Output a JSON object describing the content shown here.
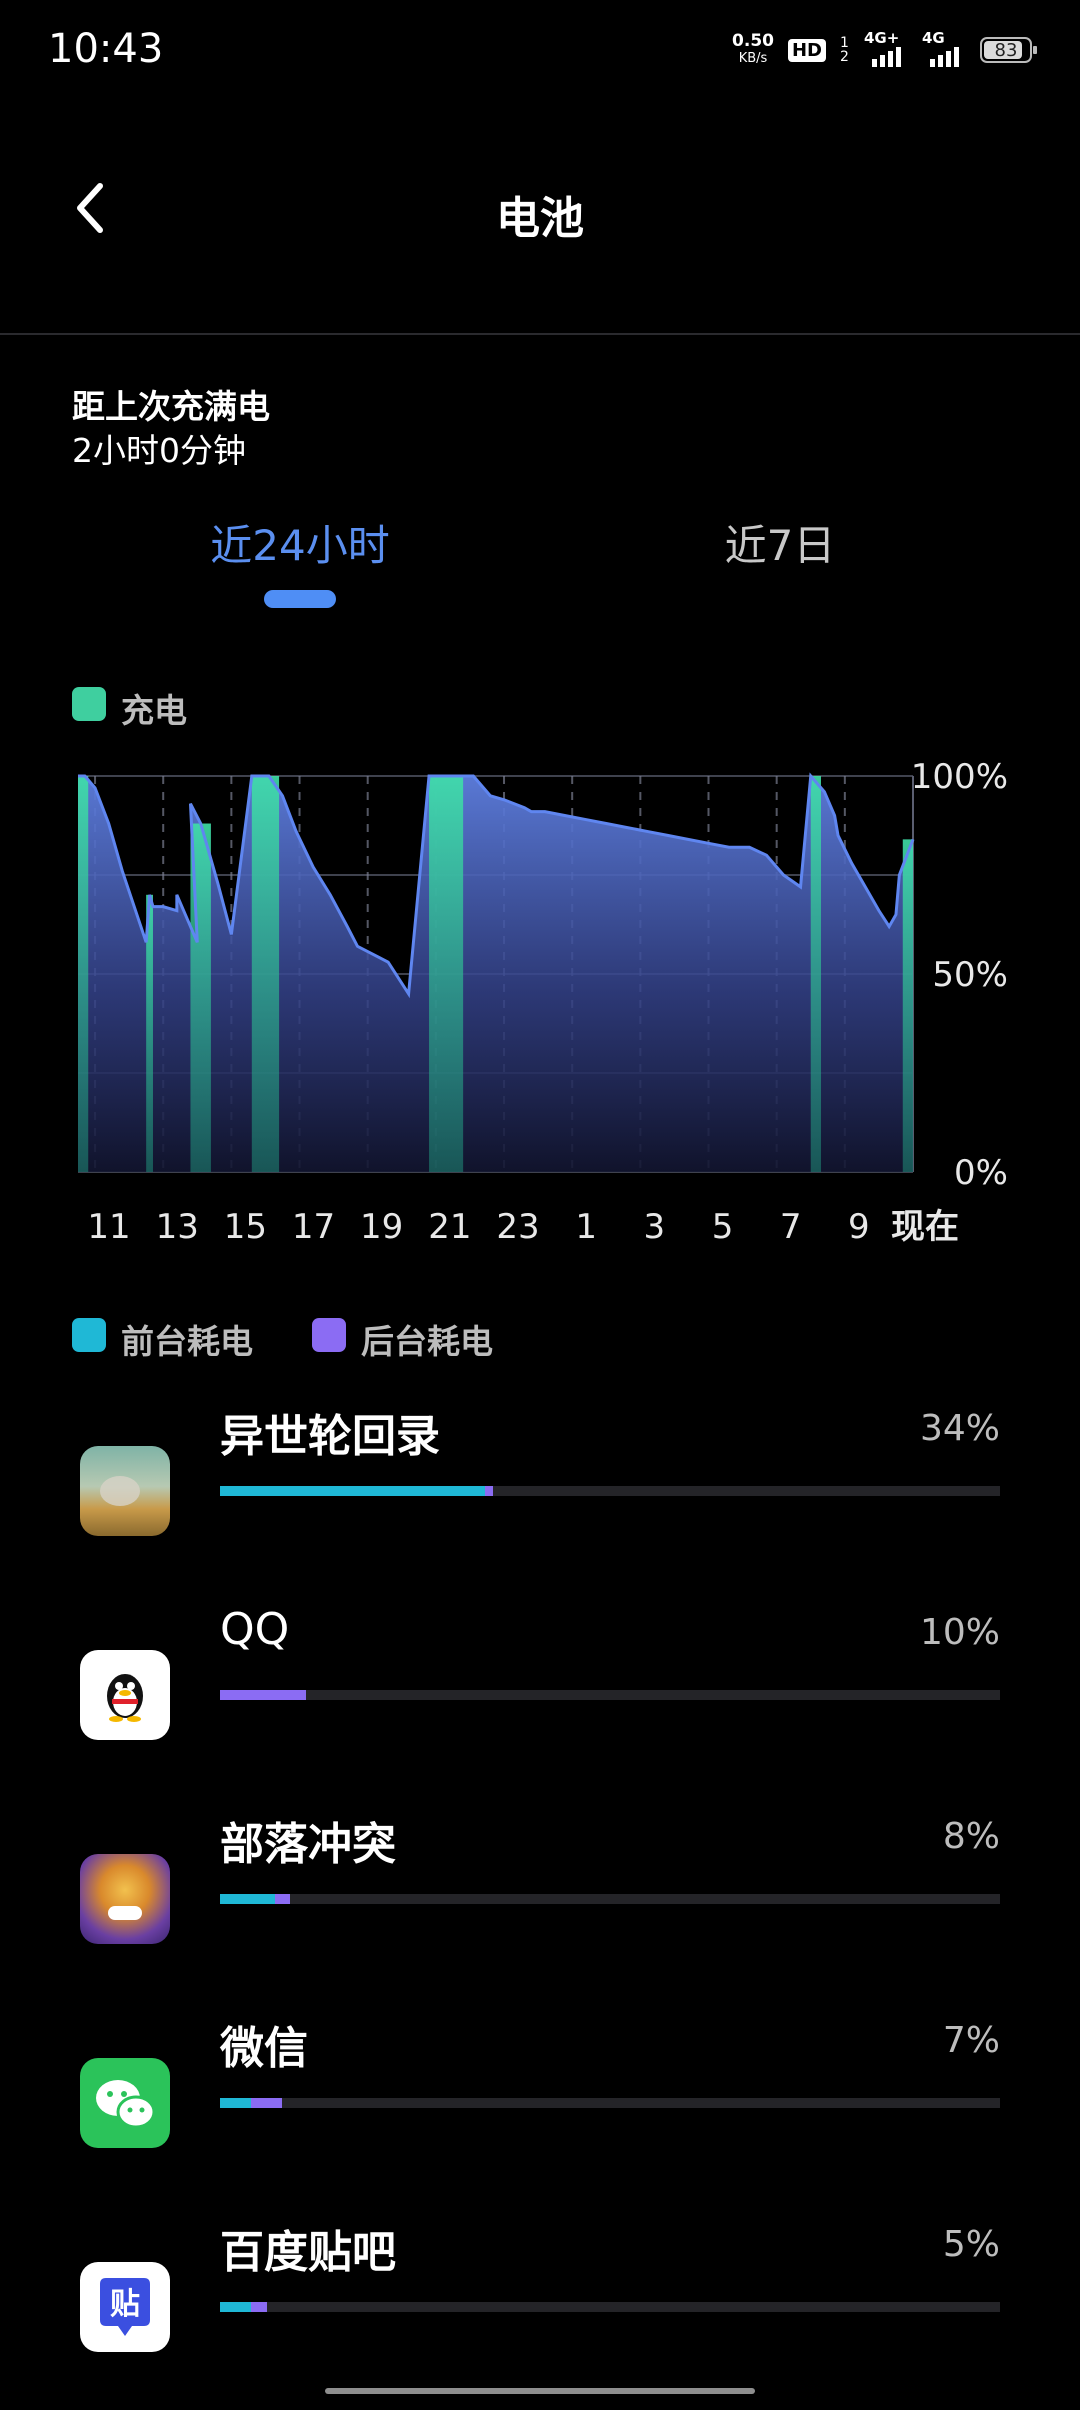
{
  "status_bar": {
    "time": "10:43",
    "net_speed_value": "0.50",
    "net_speed_unit": "KB/s",
    "hd_badge": "HD",
    "sim_slots": "1 2",
    "signal1_label": "4G+",
    "signal2_label": "4G",
    "battery_level": "83"
  },
  "header": {
    "back_icon": "chevron-left-icon",
    "title": "电池"
  },
  "since_full_charge": {
    "label": "距上次充满电",
    "value": "2小时0分钟"
  },
  "tabs": [
    {
      "label": "近24小时",
      "selected": true
    },
    {
      "label": "近7日",
      "selected": false
    }
  ],
  "charge_legend": {
    "label": "充电",
    "color": "#3fcf9f"
  },
  "chart_data": {
    "type": "area",
    "x_tick_labels": [
      "11",
      "13",
      "15",
      "17",
      "19",
      "21",
      "23",
      "1",
      "3",
      "5",
      "7",
      "9",
      "现在"
    ],
    "y_tick_labels": [
      "100%",
      "50%",
      "0%"
    ],
    "ylim": [
      0,
      100
    ],
    "x_unit": "hours ago",
    "xlim": [
      24.5,
      0
    ],
    "battery_level": {
      "x": [
        24.5,
        24.3,
        24.0,
        23.6,
        23.2,
        22.5,
        22.4,
        22.3,
        22.0,
        21.6,
        21.6,
        21.0,
        21.2,
        20.9,
        20.8,
        20.4,
        20.0,
        19.4,
        18.9,
        18.5,
        18.1,
        17.6,
        17.1,
        16.6,
        16.3,
        15.4,
        14.8,
        14.2,
        13.6,
        13.1,
        12.9,
        12.8,
        12.4,
        12.0,
        11.4,
        11.2,
        10.8,
        10.2,
        9.6,
        9.0,
        8.4,
        7.8,
        7.2,
        6.6,
        6.0,
        5.4,
        4.8,
        4.3,
        3.8,
        3.3,
        3.0,
        2.6,
        2.3,
        2.2,
        1.8,
        1.4,
        1.0,
        0.7,
        0.5,
        0.4,
        0.0
      ],
      "values": [
        100,
        100,
        97,
        88,
        76,
        58,
        70,
        67,
        67,
        66,
        70,
        58,
        93,
        88,
        85,
        73,
        60,
        100,
        100,
        95,
        86,
        77,
        70,
        62,
        57,
        53,
        45,
        100,
        100,
        100,
        100,
        99,
        95,
        94,
        92,
        91,
        91,
        90,
        89,
        88,
        87,
        86,
        85,
        84,
        83,
        82,
        82,
        80,
        75,
        72,
        100,
        96,
        90,
        85,
        78,
        72,
        66,
        62,
        65,
        75,
        84
      ]
    },
    "charging_periods": [
      [
        24.5,
        24.2
      ],
      [
        22.5,
        22.3
      ],
      [
        21.2,
        20.6
      ],
      [
        19.4,
        18.6
      ],
      [
        14.2,
        13.2
      ],
      [
        3.0,
        2.7
      ],
      [
        0.3,
        0.0
      ]
    ],
    "colors": {
      "line": "#5f86f0",
      "charging": "#3fcf9f"
    },
    "grid": true
  },
  "usage_legend": {
    "foreground_label": "前台耗电",
    "background_label": "后台耗电",
    "foreground_color": "#1fb8d6",
    "background_color": "#8b6cf3"
  },
  "apps": [
    {
      "name": "异世轮回录",
      "percent": "34%",
      "foreground_fraction": 0.34,
      "background_fraction": 0.01,
      "icon": "game-landscape-icon"
    },
    {
      "name": "QQ",
      "percent": "10%",
      "foreground_fraction": 0.0,
      "background_fraction": 0.11,
      "icon": "qq-penguin-icon"
    },
    {
      "name": "部落冲突",
      "percent": "8%",
      "foreground_fraction": 0.07,
      "background_fraction": 0.02,
      "icon": "clash-of-clans-icon"
    },
    {
      "name": "微信",
      "percent": "7%",
      "foreground_fraction": 0.04,
      "background_fraction": 0.04,
      "icon": "wechat-icon"
    },
    {
      "name": "百度贴吧",
      "percent": "5%",
      "foreground_fraction": 0.04,
      "background_fraction": 0.02,
      "icon": "tieba-icon"
    }
  ]
}
